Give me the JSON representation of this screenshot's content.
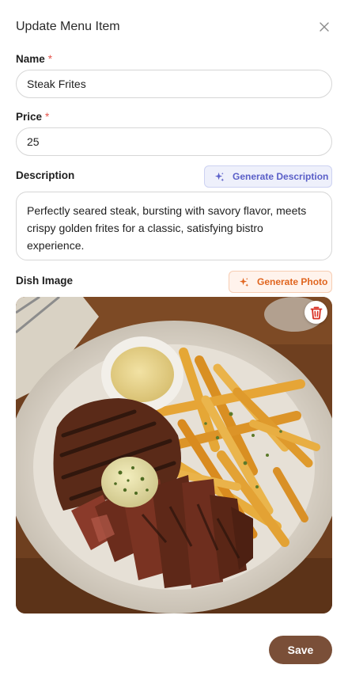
{
  "modal": {
    "title": "Update Menu Item",
    "close_icon": "close-icon"
  },
  "fields": {
    "name": {
      "label": "Name",
      "required_mark": "*",
      "value": "Steak Frites"
    },
    "price": {
      "label": "Price",
      "required_mark": "*",
      "value": "25"
    },
    "description": {
      "label": "Description",
      "value": "Perfectly seared steak, bursting with savory flavor, meets crispy golden frites for a classic, satisfying bistro experience.",
      "generate_label": "Generate Description",
      "generate_icon": "sparkle-icon"
    },
    "image": {
      "label": "Dish Image",
      "generate_label": "Generate Photo",
      "generate_icon": "sparkle-icon",
      "delete_icon": "trash-icon"
    }
  },
  "footer": {
    "save_label": "Save"
  },
  "colors": {
    "accent_description": "#5a5fc8",
    "accent_photo": "#e0651f",
    "save_button": "#7a4f38",
    "required": "#e5534b",
    "delete": "#d92d20"
  }
}
